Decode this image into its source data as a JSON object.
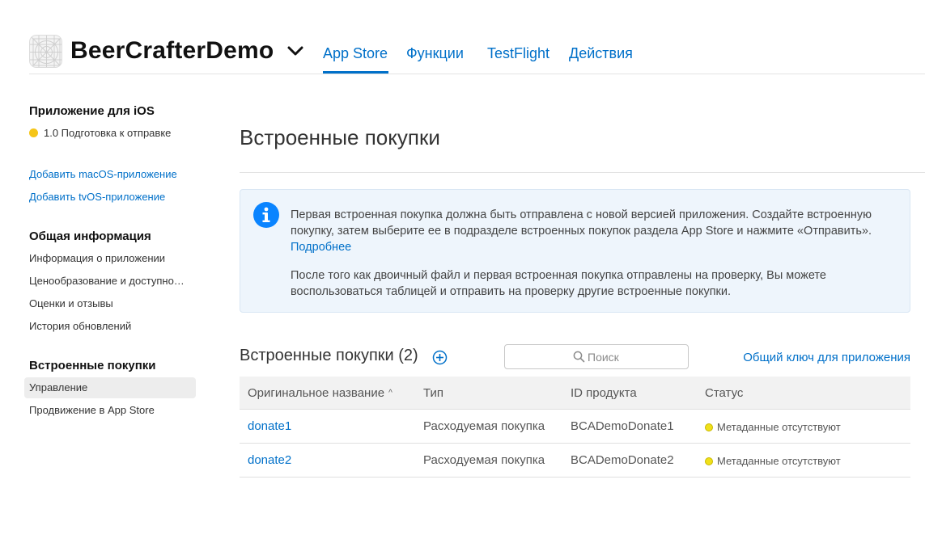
{
  "header": {
    "app_name": "BeerCrafterDemo",
    "tabs": [
      {
        "label": "App Store",
        "active": true
      },
      {
        "label": "Функции",
        "active": false
      },
      {
        "label": "TestFlight",
        "active": false
      },
      {
        "label": "Действия",
        "active": false
      }
    ]
  },
  "sidebar": {
    "ios_heading": "Приложение для iOS",
    "version_status": "1.0 Подготовка к отправке",
    "version_status_color": "#f5c518",
    "links": [
      "Добавить macOS-приложение",
      "Добавить tvOS-приложение"
    ],
    "general_heading": "Общая информация",
    "general_items": [
      "Информация о приложении",
      "Ценообразование и доступно…",
      "Оценки и отзывы",
      "История обновлений"
    ],
    "iap_heading": "Встроенные покупки",
    "iap_items": [
      {
        "label": "Управление",
        "selected": true
      },
      {
        "label": "Продвижение в App Store",
        "selected": false
      }
    ]
  },
  "main": {
    "page_title": "Встроенные покупки",
    "info": {
      "icon": "info-icon",
      "paragraph1": "Первая встроенная покупка должна быть отправлена с новой версией приложения. Создайте встроенную покупку, затем выберите ее в подразделе встроенных покупок раздела App Store и нажмите «Отправить».",
      "link": "Подробнее",
      "paragraph2": "После того как двоичный файл и первая встроенная покупка отправлены на проверку, Вы можете воспользоваться таблицей и отправить на проверку другие встроенные покупки."
    },
    "section_title": "Встроенные покупки (2)",
    "search": {
      "placeholder": "Поиск",
      "value": ""
    },
    "shared_key_link": "Общий ключ для приложения",
    "table": {
      "columns": [
        "Оригинальное название",
        "Тип",
        "ID продукта",
        "Статус"
      ],
      "sort_column": "Оригинальное название",
      "sort_direction": "ascending",
      "rows": [
        {
          "name": "donate1",
          "type": "Расходуемая покупка",
          "product_id": "BCADemoDonate1",
          "status": "Метаданные отсутствуют",
          "status_color": "#f0e01a"
        },
        {
          "name": "donate2",
          "type": "Расходуемая покупка",
          "product_id": "BCADemoDonate2",
          "status": "Метаданные отсутствуют",
          "status_color": "#f0e01a"
        }
      ]
    }
  },
  "colors": {
    "accent": "#0070c9",
    "info_background": "#eef5fc",
    "info_icon": "#0a84ff"
  }
}
